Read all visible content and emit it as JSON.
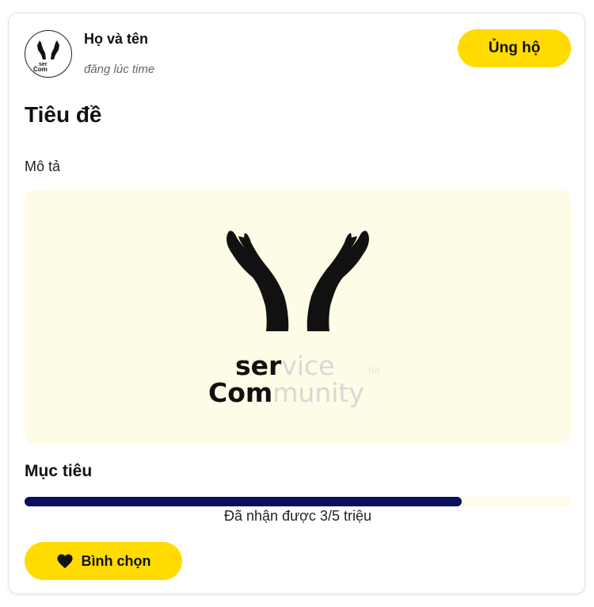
{
  "post": {
    "author_name": "Họ và tên",
    "time_text": "đăng lúc time",
    "support_label": "Ủng hộ",
    "title": "Tiêu đề",
    "description": "Mô tả"
  },
  "logo": {
    "line1_bold": "ser",
    "line1_light": "vice",
    "for_text": "for",
    "line2_bold": "Com",
    "line2_light": "munity"
  },
  "goal": {
    "label": "Mục tiêu",
    "progress_fraction": 0.8,
    "progress_text": "Đã nhận được 3/5 triệu"
  },
  "vote": {
    "label": "Bình chọn",
    "icon": "heart-icon"
  },
  "colors": {
    "accent": "#ffdb00",
    "progress": "#0a0f5c",
    "image_bg": "#fefbe6"
  }
}
